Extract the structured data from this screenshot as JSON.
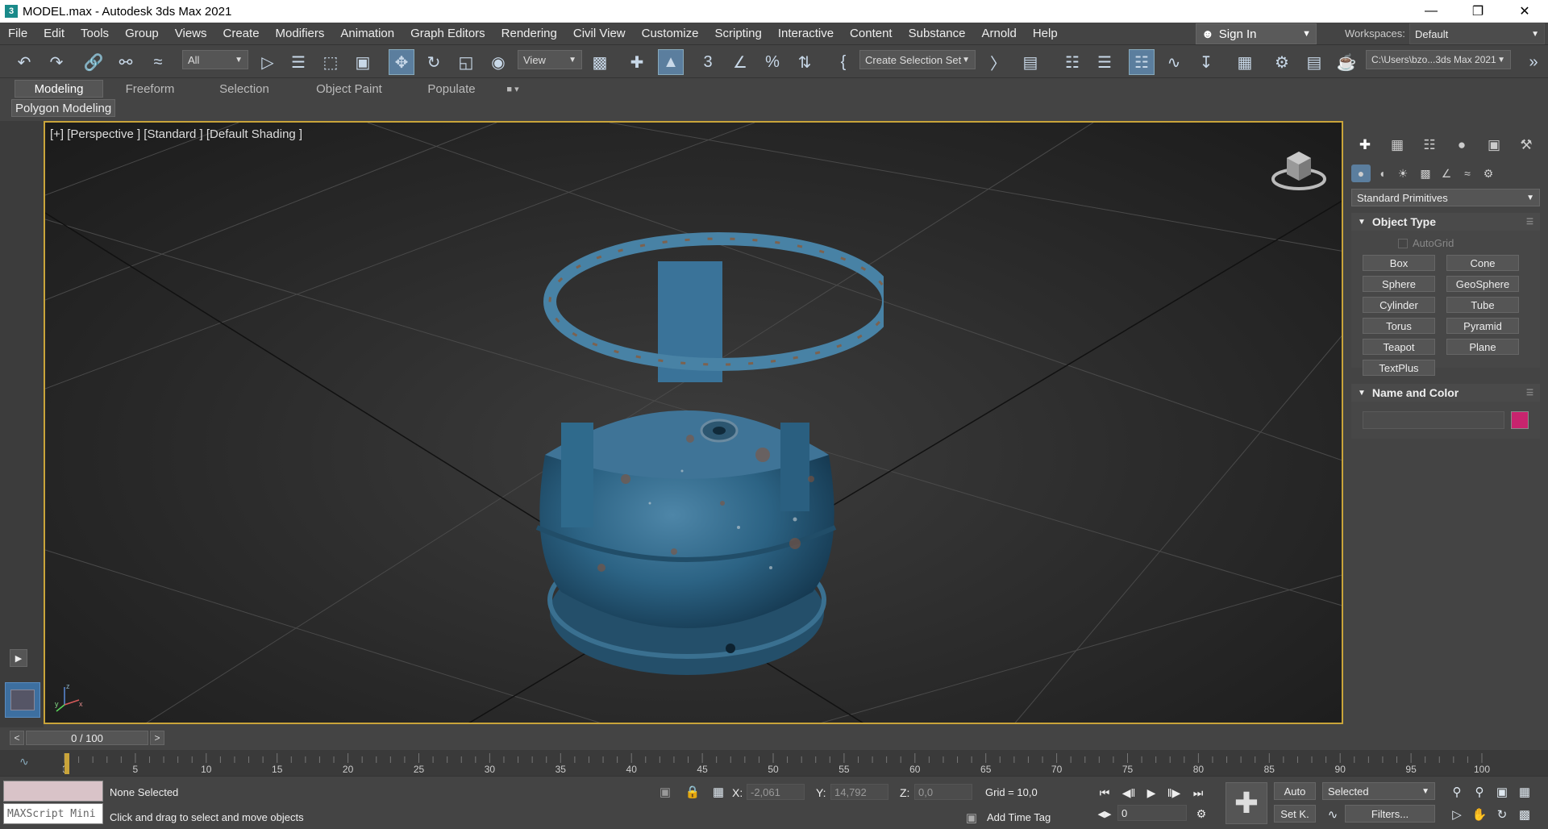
{
  "window": {
    "title": "MODEL.max - Autodesk 3ds Max 2021",
    "app_icon": "3"
  },
  "menu": [
    "File",
    "Edit",
    "Tools",
    "Group",
    "Views",
    "Create",
    "Modifiers",
    "Animation",
    "Graph Editors",
    "Rendering",
    "Civil View",
    "Customize",
    "Scripting",
    "Interactive",
    "Content",
    "Substance",
    "Arnold",
    "Help"
  ],
  "account": {
    "sign_in": "Sign In",
    "workspaces_label": "Workspaces:",
    "workspace": "Default"
  },
  "toolbar": {
    "filter": "All",
    "ref_coord": "View",
    "selection_set": "Create Selection Set",
    "project_path": "C:\\Users\\bzo...3ds Max 2021"
  },
  "ribbon": {
    "tabs": [
      "Modeling",
      "Freeform",
      "Selection",
      "Object Paint",
      "Populate"
    ],
    "active_tab": "Modeling",
    "panel": "Polygon Modeling"
  },
  "viewport": {
    "label": "[+] [Perspective ] [Standard ] [Default Shading ]",
    "axes": {
      "x": "x",
      "y": "y",
      "z": "z"
    }
  },
  "command_panel": {
    "category": "Standard Primitives",
    "object_type": {
      "title": "Object Type",
      "autogrid": "AutoGrid",
      "buttons": [
        "Box",
        "Cone",
        "Sphere",
        "GeoSphere",
        "Cylinder",
        "Tube",
        "Torus",
        "Pyramid",
        "Teapot",
        "Plane",
        "TextPlus"
      ]
    },
    "name_color": {
      "title": "Name and Color",
      "color": "#c8246e"
    }
  },
  "timeline": {
    "slider": "0 / 100",
    "prev": "<",
    "next": ">",
    "ticks": [
      "0",
      "5",
      "10",
      "15",
      "20",
      "25",
      "30",
      "35",
      "40",
      "45",
      "50",
      "55",
      "60",
      "65",
      "70",
      "75",
      "80",
      "85",
      "90",
      "95",
      "100"
    ],
    "current_frame": 0
  },
  "status": {
    "listener": "MAXScript Mini",
    "selection": "None Selected",
    "prompt": "Click and drag to select and move objects",
    "x_label": "X:",
    "x": "-2,061",
    "y_label": "Y:",
    "y": "14,792",
    "z_label": "Z:",
    "z": "0,0",
    "grid": "Grid = 10,0",
    "time_tag": "Add Time Tag",
    "frame": "0",
    "auto": "Auto",
    "set_key": "Set K.",
    "key_filter": "Selected",
    "filters": "Filters..."
  }
}
